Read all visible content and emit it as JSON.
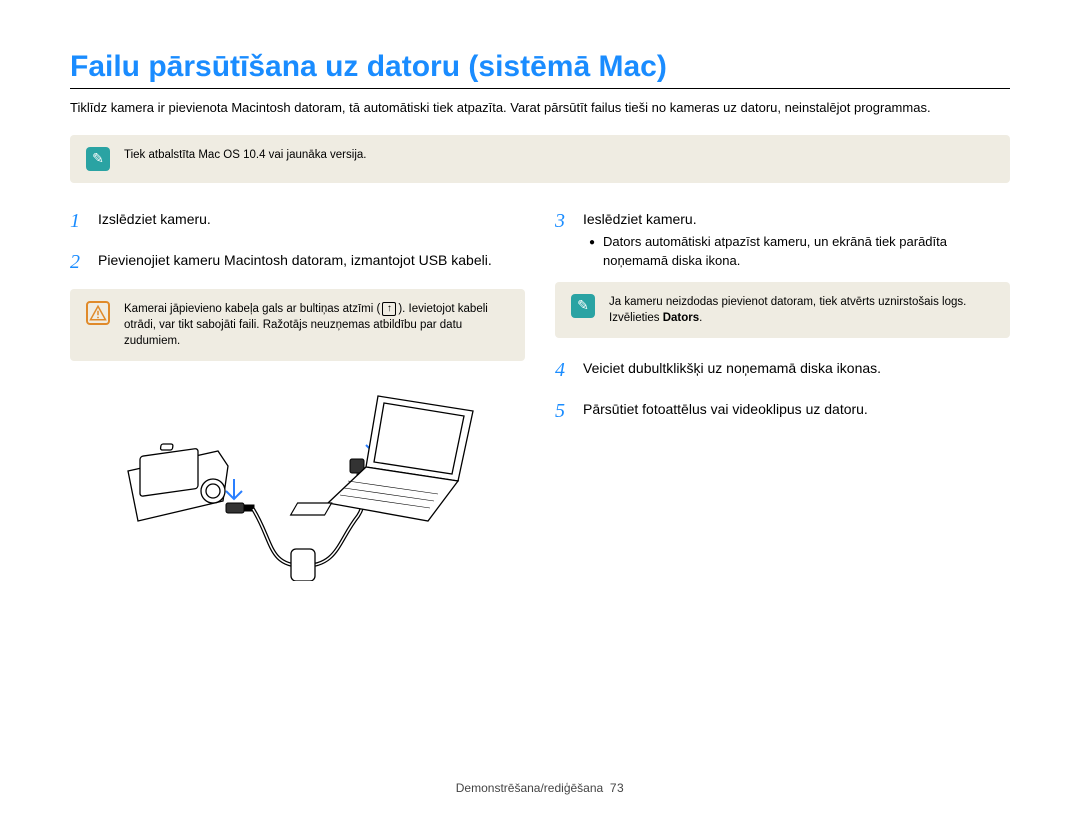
{
  "title": "Failu pārsūtīšana uz datoru (sistēmā Mac)",
  "intro": "Tiklīdz kamera ir pievienota Macintosh datoram, tā automātiski tiek atpazīta. Varat pārsūtīt failus tieši no kameras uz datoru, neinstalējot programmas.",
  "note_box_top": "Tiek atbalstīta Mac OS 10.4 vai jaunāka versija.",
  "steps": {
    "s1": "Izslēdziet kameru.",
    "s2": "Pievienojiet kameru Macintosh datoram, izmantojot USB kabeli.",
    "s3": "Ieslēdziet kameru.",
    "s3_sub": "Dators automātiski atpazīst kameru, un ekrānā tiek parādīta noņemamā diska ikona.",
    "s4": "Veiciet dubultklikšķi uz noņemamā diska ikonas.",
    "s5": "Pārsūtiet fotoattēlus vai videoklipus uz datoru."
  },
  "warn_box_pre": "Kamerai jāpievieno kabeļa gals ar bultiņas atzīmi (",
  "warn_box_post": "). Ievietojot kabeli otrādi, var tikt sabojāti faili. Ražotājs neuzņemas atbildību par datu zudumiem.",
  "note_box_right_pre": "Ja kameru neizdodas pievienot datoram, tiek atvērts uznirstošais logs. Izvēlieties ",
  "note_box_right_bold": "Dators",
  "note_box_right_post": ".",
  "footer_section": "Demonstrēšana/rediģēšana",
  "footer_page": "73"
}
